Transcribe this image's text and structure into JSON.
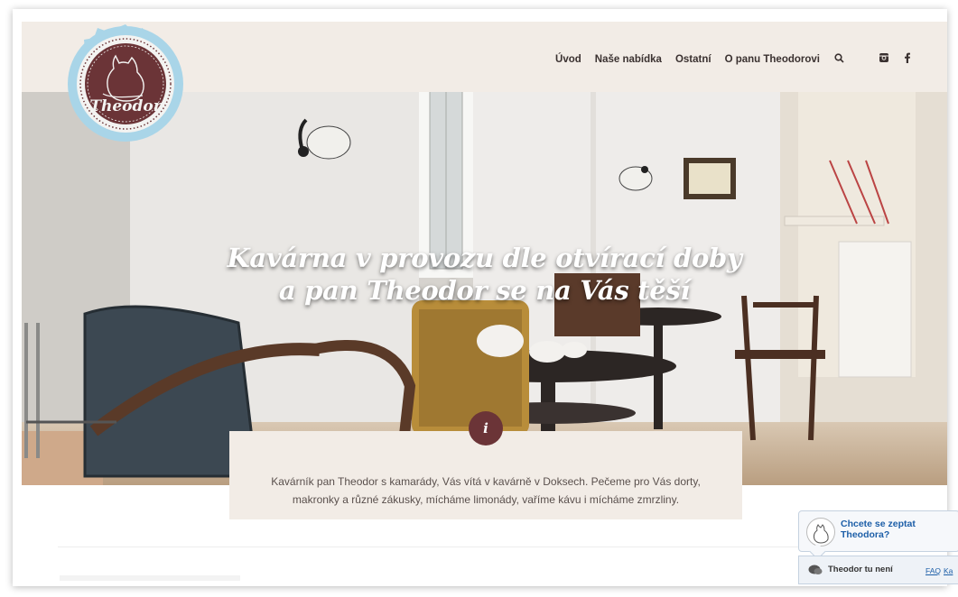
{
  "brand": {
    "logo_text": "Theodor"
  },
  "nav": {
    "items": [
      "Úvod",
      "Naše nabídka",
      "Ostatní",
      "O panu Theodorovi"
    ],
    "icons": [
      "search-icon",
      "instagram-icon",
      "facebook-icon"
    ]
  },
  "hero": {
    "headline_line1": "Kavárna v provozu dle otvírací doby",
    "headline_line2": "a pan Theodor se na Vás těší"
  },
  "info": {
    "icon_letter": "i",
    "text": "Kavárník pan Theodor s kamarády, Vás vítá v kavárně v Doksech. Pečeme pro Vás dorty, makronky a různé zákusky, mícháme limonády, vaříme kávu i mícháme zmrzliny."
  },
  "chat": {
    "prompt": "Chcete se zeptat Theodora?",
    "status": "Theodor tu není",
    "faq": "FAQ",
    "ka": "Ka"
  },
  "colors": {
    "header_bg": "#f2ece6",
    "brand_maroon": "#6b3437",
    "logo_badge": "#a9d5e8",
    "link_blue": "#1d5fa8"
  }
}
